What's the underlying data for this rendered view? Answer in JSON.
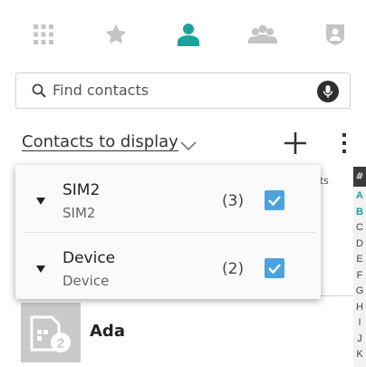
{
  "tabs": [
    {
      "icon": "apps-grid-icon"
    },
    {
      "icon": "star-icon"
    },
    {
      "icon": "person-icon",
      "active": true
    },
    {
      "icon": "group-icon"
    },
    {
      "icon": "shield-person-icon"
    }
  ],
  "search": {
    "placeholder": "Find contacts"
  },
  "filter": {
    "label": "Contacts to display"
  },
  "background": {
    "tab_fragment": "acts"
  },
  "index": {
    "header": "#",
    "letters": [
      "A",
      "B",
      "C",
      "D",
      "E",
      "F",
      "G",
      "H",
      "I",
      "J",
      "K"
    ],
    "active_letters": [
      "A",
      "B"
    ]
  },
  "popup": {
    "accounts": [
      {
        "title": "SIM2",
        "subtitle": "SIM2",
        "count": "(3)",
        "checked": true
      },
      {
        "title": "Device",
        "subtitle": "Device",
        "count": "(2)",
        "checked": true
      }
    ]
  },
  "contact": {
    "name": "Ada",
    "avatar_badge": "2"
  },
  "colors": {
    "accent": "#1aa39a",
    "checkbox": "#4aa3df",
    "inactive_icon": "#c4c4c4"
  }
}
